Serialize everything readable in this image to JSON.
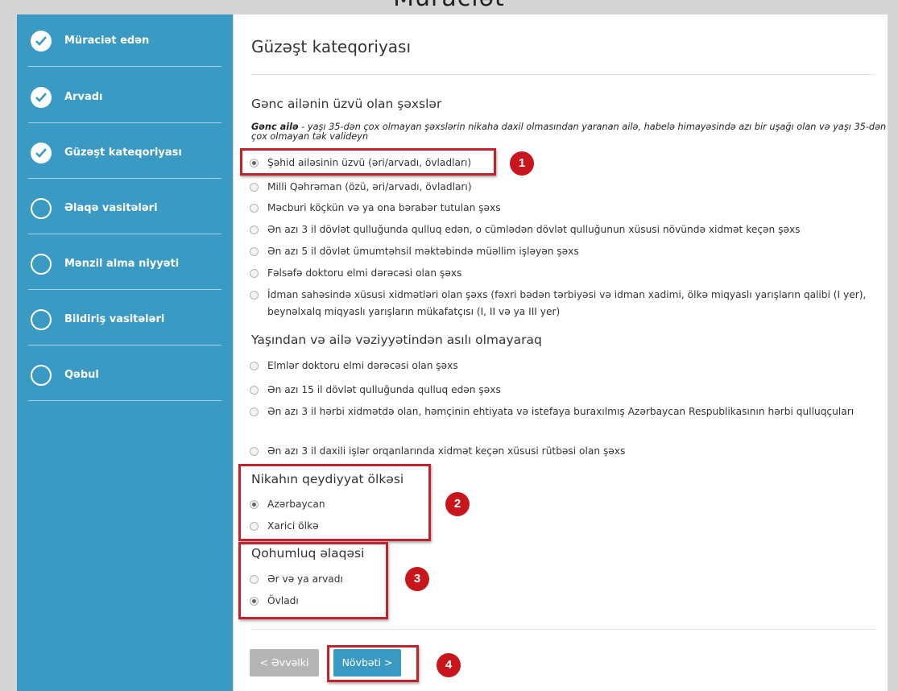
{
  "page_title": "Müraciət",
  "sidebar": {
    "steps": [
      {
        "label": "Müraciət edən",
        "done": true
      },
      {
        "label": "Arvadı",
        "done": true
      },
      {
        "label": "Güzəşt kateqoriyası",
        "done": true
      },
      {
        "label": "Əlaqə vasitələri",
        "done": false
      },
      {
        "label": "Mənzil alma niyyəti",
        "done": false
      },
      {
        "label": "Bildiriş vasitələri",
        "done": false
      },
      {
        "label": "Qəbul",
        "done": false
      }
    ]
  },
  "main": {
    "title": "Güzəşt kateqoriyası",
    "section1": {
      "heading": "Gənc ailənin üzvü olan şəxslər",
      "note_bold": "Gənc ailə",
      "note_text": " - yaşı 35-dən çox olmayan şəxslərin nikaha daxil olmasından yaranan ailə, habelə himayəsində azı bir uşağı olan və yaşı 35-dən çox olmayan tək valideyn",
      "options": [
        {
          "label": "Şəhid ailəsinin üzvü (əri/arvadı, övladları)",
          "selected": true
        },
        {
          "label": "Milli Qəhrəman (özü, əri/arvadı, övladları)",
          "selected": false
        },
        {
          "label": "Məcburi köçkün və ya ona bərabər tutulan şəxs",
          "selected": false
        },
        {
          "label": "Ən azı 3 il dövlət qulluğunda qulluq edən, o cümlədən dövlət qulluğunun xüsusi növündə xidmət keçən şəxs",
          "selected": false
        },
        {
          "label": "Ən azı 5 il dövlət ümumtəhsil məktəbində müəllim işləyən şəxs",
          "selected": false
        },
        {
          "label": "Fəlsəfə doktoru elmi dərəcəsi olan şəxs",
          "selected": false
        },
        {
          "label": "İdman sahəsində xüsusi xidmətləri olan şəxs (fəxri bədən tərbiyəsi və idman xadimi, ölkə miqyaslı yarışların qalibi (I yer), beynəlxalq miqyaslı yarışların mükafatçısı (I, II və ya III yer)",
          "selected": false
        }
      ]
    },
    "section2": {
      "heading": "Yaşından və ailə vəziyyətindən asılı olmayaraq",
      "options": [
        {
          "label": "Elmlər doktoru elmi dərəcəsi olan şəxs",
          "selected": false
        },
        {
          "label": "Ən azı 15 il dövlət qulluğunda qulluq edən şəxs",
          "selected": false
        },
        {
          "label": "Ən azı 3 il hərbi xidmətdə olan, həmçinin ehtiyata və istefaya buraxılmış Azərbaycan Respublikasının hərbi qulluqçuları",
          "selected": false
        },
        {
          "label": "Ən azı 3 il daxili işlər orqanlarında xidmət keçən xüsusi rütbəsi olan şəxs",
          "selected": false
        }
      ]
    },
    "section3": {
      "heading": "Nikahın qeydiyyat ölkəsi",
      "options": [
        {
          "label": "Azərbaycan",
          "selected": true
        },
        {
          "label": "Xarici ölkə",
          "selected": false
        }
      ]
    },
    "section4": {
      "heading": "Qohumluq əlaqəsi",
      "options": [
        {
          "label": "Ər və ya arvadı",
          "selected": false
        },
        {
          "label": "Övladı",
          "selected": true
        }
      ]
    },
    "buttons": {
      "prev": "< Əvvəlki",
      "next": "Növbəti >"
    }
  },
  "annotations": {
    "badge1": "1",
    "badge2": "2",
    "badge3": "3",
    "badge4": "4",
    "color": "#c0232b"
  },
  "colors": {
    "sidebar": "#3a9ac3",
    "accent": "#3a9ac3",
    "badge": "#c9161d"
  }
}
